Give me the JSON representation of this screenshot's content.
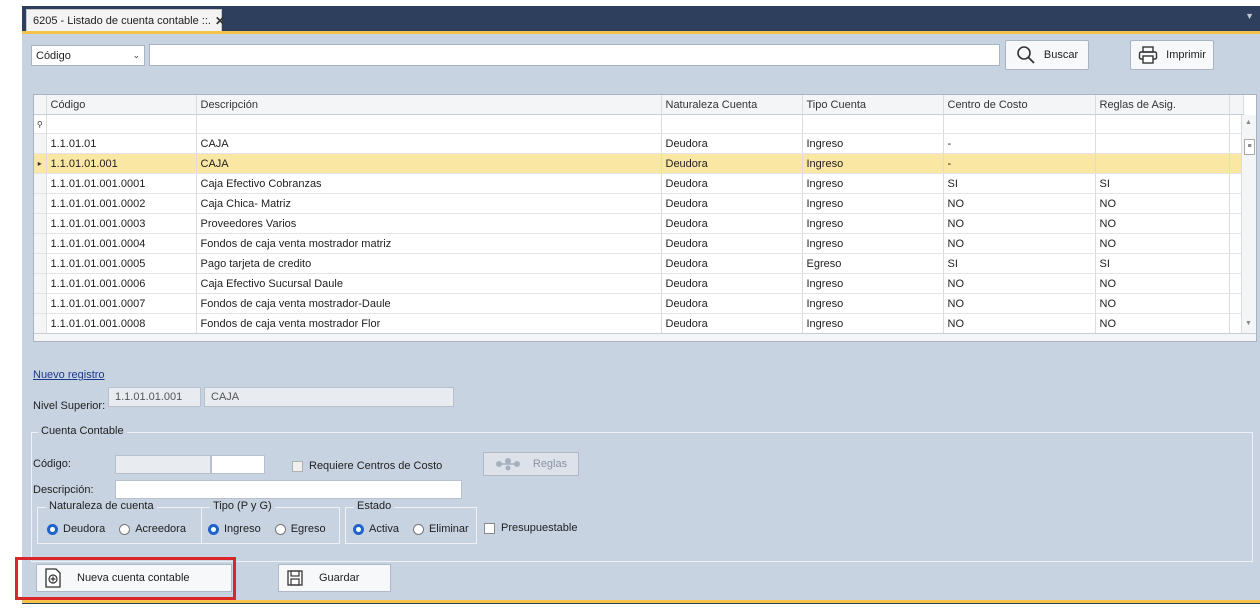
{
  "tab": {
    "title": "6205 - Listado de cuenta contable ::.",
    "close": "✕",
    "menu": "▼"
  },
  "toolbar": {
    "filter_field": "Código",
    "search_value": "",
    "buscar_label": "Buscar",
    "imprimir_label": "Imprimir"
  },
  "grid": {
    "columns": [
      "Código",
      "Descripción",
      "Naturaleza Cuenta",
      "Tipo Cuenta",
      "Centro de Costo",
      "Reglas de Asig."
    ],
    "rows": [
      [
        "1.1.01.01",
        "CAJA",
        "Deudora",
        "Ingreso",
        "-",
        ""
      ],
      [
        "1.1.01.01.001",
        "CAJA",
        "Deudora",
        "Ingreso",
        "-",
        ""
      ],
      [
        "1.1.01.01.001.0001",
        "Caja Efectivo Cobranzas",
        "Deudora",
        "Ingreso",
        "SI",
        "SI"
      ],
      [
        "1.1.01.01.001.0002",
        "Caja Chica- Matriz",
        "Deudora",
        "Ingreso",
        "NO",
        "NO"
      ],
      [
        "1.1.01.01.001.0003",
        "Proveedores Varios",
        "Deudora",
        "Ingreso",
        "NO",
        "NO"
      ],
      [
        "1.1.01.01.001.0004",
        "Fondos de caja venta mostrador matriz",
        "Deudora",
        "Ingreso",
        "NO",
        "NO"
      ],
      [
        "1.1.01.01.001.0005",
        "Pago tarjeta de credito",
        "Deudora",
        "Egreso",
        "SI",
        "SI"
      ],
      [
        "1.1.01.01.001.0006",
        "Caja Efectivo Sucursal Daule",
        "Deudora",
        "Ingreso",
        "NO",
        "NO"
      ],
      [
        "1.1.01.01.001.0007",
        "Fondos de caja venta mostrador-Daule",
        "Deudora",
        "Ingreso",
        "NO",
        "NO"
      ],
      [
        "1.1.01.01.001.0008",
        "Fondos de caja venta mostrador Flor",
        "Deudora",
        "Ingreso",
        "NO",
        "NO"
      ]
    ],
    "selected_row": 1
  },
  "form": {
    "nuevo_registro": "Nuevo registro",
    "nivel_superior_label": "Nivel Superior:",
    "nivel_superior_code": "1.1.01.01.001",
    "nivel_superior_name": "CAJA",
    "cuenta_group": "Cuenta Contable",
    "codigo_label": "Código:",
    "requiere_centros": "Requiere Centros de Costo",
    "reglas_label": "Reglas",
    "descripcion_label": "Descripción:",
    "naturaleza_group": "Naturaleza de cuenta",
    "naturaleza_options": [
      "Deudora",
      "Acreedora"
    ],
    "tipo_group": "Tipo (P y G)",
    "tipo_options": [
      "Ingreso",
      "Egreso"
    ],
    "estado_group": "Estado",
    "estado_options": [
      "Activa",
      "Eliminar"
    ],
    "presupuestable": "Presupuestable"
  },
  "actions": {
    "nueva_cuenta": "Nueva cuenta contable",
    "guardar": "Guardar"
  },
  "colors": {
    "accent": "#f5c24a",
    "selected_row": "#fbe7a4",
    "highlight": "#d9262a",
    "radio_on": "#1e63c8"
  }
}
